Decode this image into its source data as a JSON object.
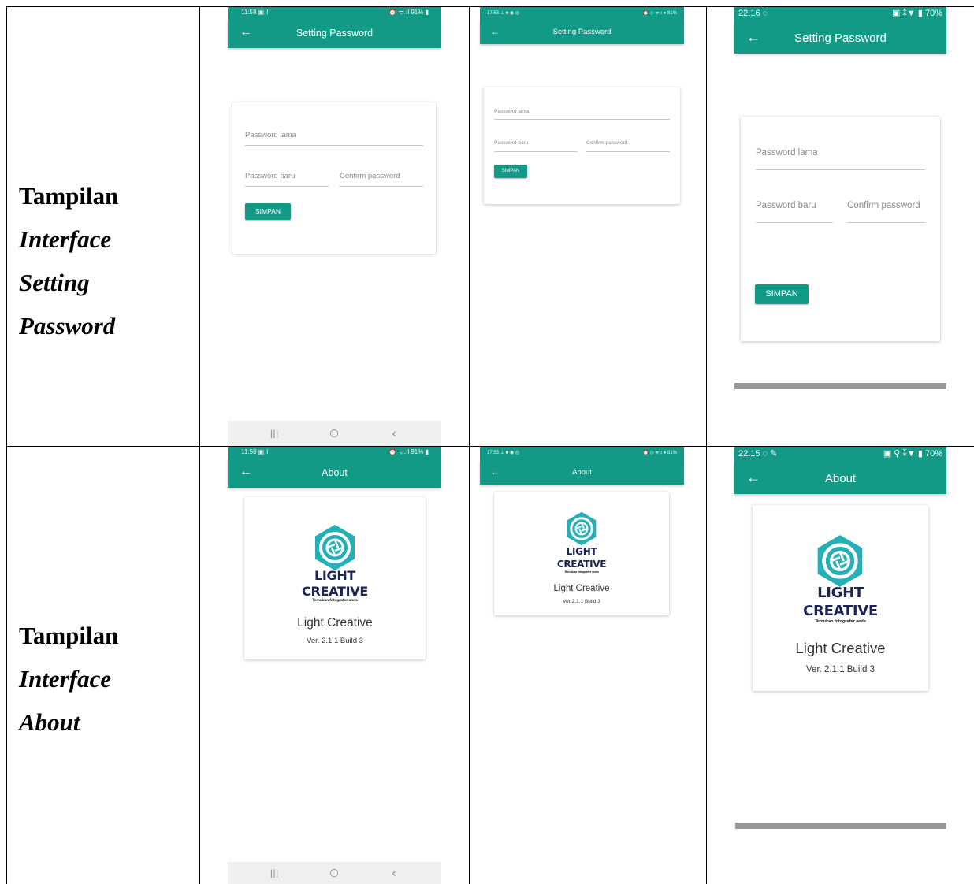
{
  "rows": [
    {
      "label_lines": [
        "Tampilan",
        "Interface",
        "Setting",
        "Password"
      ]
    },
    {
      "label_lines": [
        "Tampilan",
        "Interface",
        "About"
      ]
    }
  ],
  "colors": {
    "primary": "#129a87",
    "logo_text": "#1c2454",
    "nav_bg": "#efefef"
  },
  "setting_password": {
    "title": "Setting Password",
    "old_password_placeholder": "Password lama",
    "new_password_placeholder": "Password baru",
    "confirm_password_placeholder": "Confirm password",
    "save_label": "SIMPAN"
  },
  "about": {
    "title": "About",
    "logo_line1": "LIGHT",
    "logo_line2": "CREATIVE",
    "logo_tagline": "Temukan fotografer anda",
    "app_name": "Light Creative",
    "version": "Ver. 2.1.1 Build 3",
    "version_small": "Ver 2.1.1 Build 3"
  },
  "status": {
    "s1_setting": {
      "left": "11:58 ▣ ⌇",
      "right": "⏰ ᯤ.ıl 91% ▮"
    },
    "s2_setting": {
      "left": "17.53 ⊥ ■ ◉ ◎",
      "right": "⏰ ◇ ᯤ.ı ● 81%"
    },
    "s3_setting": {
      "left": "22.16 ◌",
      "right": "▣ ⁑▼ ▮ 70%"
    },
    "s1_about": {
      "left": "11:58 ▣ ⌇",
      "right": "⏰ ᯤ.ıl 91% ▮"
    },
    "s2_about": {
      "left": "17.53 ⊥ ■ ◉ ◎",
      "right": "⏰ ◇ ᯤ.ı ● 81%"
    },
    "s3_about": {
      "left": "22.15 ◌ ✎",
      "right": "▣ ⚲ ⁑▼ ▮ 70%"
    }
  },
  "nav": {
    "recent": "|||",
    "home": "○",
    "back": "‹"
  },
  "icons": {
    "back": "arrow-left-icon",
    "camera": "camera-aperture-icon"
  }
}
